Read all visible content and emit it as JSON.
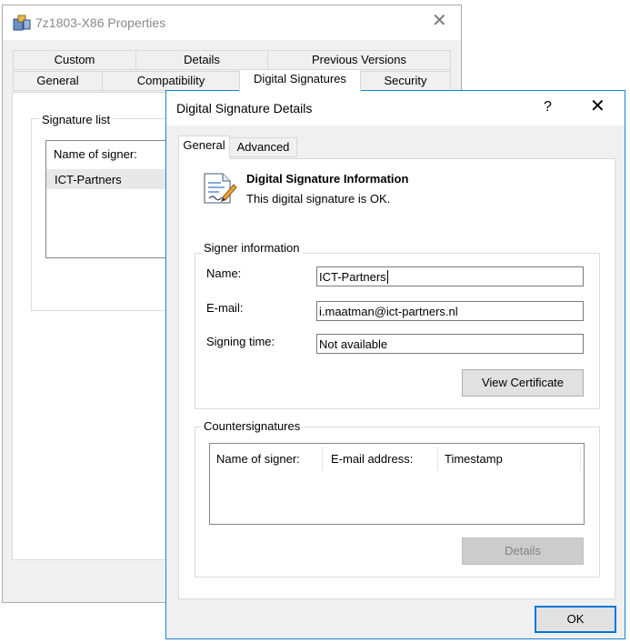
{
  "properties_window": {
    "title": "7z1803-X86 Properties",
    "close_glyph": "✕",
    "tabs_row1": [
      "Custom",
      "Details",
      "Previous Versions"
    ],
    "tabs_row2": [
      "General",
      "Compatibility",
      "Digital Signatures",
      "Security"
    ],
    "selected_tab": "Digital Signatures",
    "signature_list_label": "Signature list",
    "list_header": "Name of signer:",
    "list_rows": [
      "ICT-Partners"
    ]
  },
  "dialog": {
    "title": "Digital Signature Details",
    "help_glyph": "?",
    "close_glyph": "✕",
    "tabs": [
      "General",
      "Advanced"
    ],
    "selected_tab": "General",
    "info_heading": "Digital Signature Information",
    "info_status": "This digital signature is OK.",
    "signer_group_label": "Signer information",
    "fields": {
      "name_label": "Name:",
      "name_value": "ICT-Partners",
      "email_label": "E-mail:",
      "email_value": "i.maatman@ict-partners.nl",
      "signing_time_label": "Signing time:",
      "signing_time_value": "Not available"
    },
    "view_certificate_button": "View Certificate",
    "counter_group_label": "Countersignatures",
    "counter_columns": [
      "Name of signer:",
      "E-mail address:",
      "Timestamp"
    ],
    "details_button": "Details",
    "ok_button": "OK"
  },
  "colors": {
    "dialog_border": "#1883d7",
    "default_button_border": "#0078d7",
    "window_bg": "#f0f0f0"
  },
  "icons": [
    "installer-app-icon",
    "certificate-document-icon"
  ]
}
